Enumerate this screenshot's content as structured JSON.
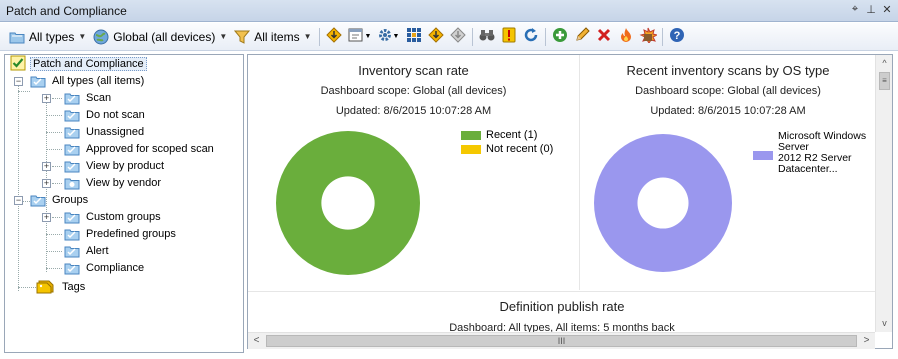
{
  "window": {
    "title": "Patch and Compliance",
    "controls": [
      "pin-icon",
      "dock-icon",
      "close-icon"
    ],
    "control_glyphs": [
      "⌖",
      "⊥",
      "✕"
    ]
  },
  "toolbar": {
    "type_filter": "All types",
    "scope_filter": "Global (all devices)",
    "items_filter": "All items",
    "buttons": [
      "download-icon",
      "schedule-icon",
      "settings-icon",
      "grid-icon",
      "download-updates-icon",
      "diamond-icon",
      "find-icon",
      "exclamation-icon",
      "refresh-icon",
      "add-icon",
      "edit-icon",
      "delete-icon",
      "fire-icon",
      "explode-icon",
      "help-icon"
    ]
  },
  "tree": {
    "root": "Patch and Compliance",
    "all_types": "All types (all items)",
    "scan": "Scan",
    "do_not_scan": "Do not scan",
    "unassigned": "Unassigned",
    "approved": "Approved for scoped scan",
    "by_product": "View by product",
    "by_vendor": "View by vendor",
    "groups": "Groups",
    "custom_groups": "Custom groups",
    "predefined_groups": "Predefined groups",
    "alert": "Alert",
    "compliance": "Compliance",
    "tags": "Tags"
  },
  "charts": {
    "inventory": {
      "title": "Inventory scan rate",
      "scope": "Dashboard scope: Global (all devices)",
      "updated": "Updated: 8/6/2015 10:07:28 AM"
    },
    "os": {
      "title": "Recent inventory scans by OS type",
      "scope": "Dashboard scope: Global (all devices)",
      "updated": "Updated: 8/6/2015 10:07:28 AM"
    },
    "definition": {
      "title": "Definition publish rate",
      "scope": "Dashboard: All types, All items:  5 months back"
    }
  },
  "chart_data": [
    {
      "type": "pie",
      "title": "Inventory scan rate",
      "categories": [
        "Recent (1)",
        "Not recent (0)"
      ],
      "values": [
        1,
        0
      ],
      "colors": [
        "#6aae3c",
        "#f5c800"
      ],
      "donut": true,
      "legend": "right"
    },
    {
      "type": "pie",
      "title": "Recent inventory scans by OS type",
      "categories": [
        "Microsoft Windows Server 2012 R2 Server Datacenter..."
      ],
      "legend_lines": [
        "Microsoft Windows",
        "Server",
        "2012 R2 Server",
        "Datacenter..."
      ],
      "values": [
        1
      ],
      "colors": [
        "#9a97ee"
      ],
      "donut": true,
      "legend": "right"
    }
  ],
  "scrollbars": {
    "v_thumb_glyph": "≡",
    "h_thumb_glyph": "III",
    "up": "^",
    "down": "v",
    "left": "<",
    "right": ">"
  }
}
